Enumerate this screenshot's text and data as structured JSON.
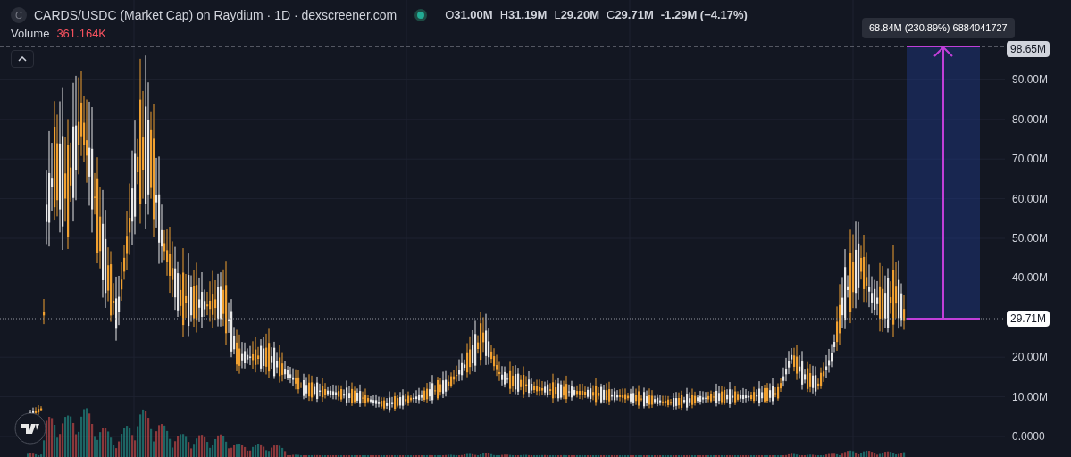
{
  "header": {
    "token_initial": "C",
    "title": "CARDS/USDC (Market Cap) on Raydium · 1D · dexscreener.com",
    "ohlc": [
      {
        "label": "O",
        "value": "31.00M"
      },
      {
        "label": "H",
        "value": "31.19M"
      },
      {
        "label": "L",
        "value": "29.20M"
      },
      {
        "label": "C",
        "value": "29.71M"
      }
    ],
    "change": "-1.29M (−4.17%)"
  },
  "volume": {
    "label": "Volume",
    "value": "361.164K"
  },
  "y_axis": {
    "ticks": [
      "90.00M",
      "80.00M",
      "70.00M",
      "60.00M",
      "50.00M",
      "40.00M",
      "20.00M",
      "10.00M",
      "0.0000"
    ]
  },
  "measure": {
    "tooltip": "68.84M (230.89%) 6884041727",
    "top_price": "98.65M"
  },
  "last_price": "29.71M"
}
